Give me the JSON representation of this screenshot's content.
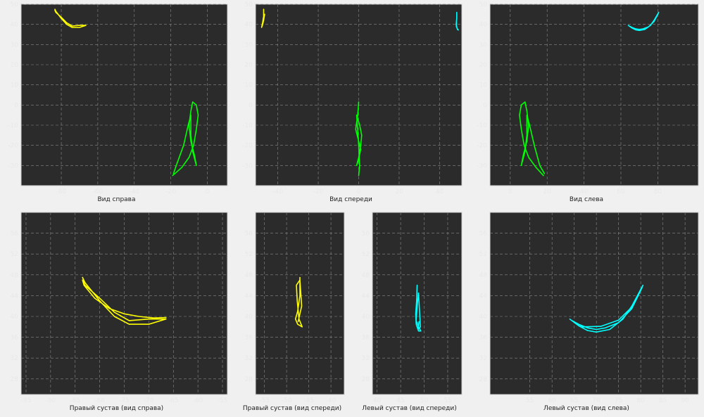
{
  "chart_data": [
    {
      "type": "line",
      "title": "Вид справа",
      "xlim": [
        -102,
        11
      ],
      "ylim": [
        -40,
        50
      ],
      "xticks": [
        -80,
        -60,
        -40,
        -20,
        0
      ],
      "yticks": [
        -30,
        -20,
        -10,
        0,
        10,
        20,
        30,
        40,
        50
      ],
      "grid": true,
      "series": [
        {
          "color": "#ffff00",
          "x": [
            -83.5,
            -83,
            -80,
            -77,
            -74,
            -70,
            -66.5,
            -70,
            -74,
            -77,
            -80,
            -83,
            -83.5
          ],
          "y": [
            47.5,
            46.5,
            43,
            40,
            38.5,
            38.5,
            39.5,
            39.5,
            39.2,
            40.8,
            43.5,
            46,
            47
          ]
        },
        {
          "color": "#00ff00",
          "x": [
            -19,
            -14,
            -10,
            -7.5,
            -6,
            -5,
            -6,
            -8,
            -9,
            -10,
            -9,
            -7,
            -6,
            -8,
            -9,
            -9,
            -10.5,
            -13,
            -17,
            -18.5
          ],
          "y": [
            -35,
            -31,
            -26,
            -20,
            -12,
            -5,
            0,
            1.5,
            -3,
            -10,
            -18,
            -25,
            -30,
            -23,
            -15,
            -5,
            -10,
            -20,
            -30,
            -34
          ]
        }
      ]
    },
    {
      "type": "line",
      "title": "Вид спереди",
      "xlim": [
        -51,
        51
      ],
      "ylim": [
        -40,
        50
      ],
      "xticks": [
        -40,
        -20,
        0,
        20,
        40
      ],
      "yticks": [
        -30,
        -20,
        -10,
        0,
        10,
        20,
        30,
        40,
        50
      ],
      "grid": true,
      "series": [
        {
          "color": "#ffff00",
          "x": [
            -47,
            -47,
            -47.5,
            -48,
            -47.5,
            -47,
            -46.5
          ],
          "y": [
            47.5,
            44,
            41,
            38.5,
            40,
            42,
            45
          ]
        },
        {
          "color": "#00ffff",
          "x": [
            48.5,
            48.5,
            48.2,
            48.8,
            49.3,
            48.8,
            48.3,
            48.4
          ],
          "y": [
            46,
            43,
            40,
            37.5,
            37.2,
            37.8,
            39,
            41
          ]
        },
        {
          "color": "#00ff00",
          "x": [
            0,
            -0.5,
            -1.5,
            0,
            1,
            0,
            -1,
            0,
            1,
            1.5,
            0.5,
            -1,
            0,
            0.5,
            0
          ],
          "y": [
            1.5,
            -5,
            -12,
            -18,
            -22,
            -27,
            -30,
            -26,
            -20,
            -15,
            -10,
            -5,
            -20,
            -30,
            -35
          ]
        }
      ]
    },
    {
      "type": "line",
      "title": "Вид слева",
      "xlim": [
        -11,
        102
      ],
      "ylim": [
        -40,
        50
      ],
      "xticks": [
        0,
        20,
        40,
        60,
        80
      ],
      "yticks": [
        -30,
        -20,
        -10,
        0,
        10,
        20,
        30,
        40,
        50
      ],
      "grid": true,
      "series": [
        {
          "color": "#00ffff",
          "x": [
            64,
            66,
            68,
            70,
            73,
            76,
            78,
            80.5,
            80,
            78,
            75,
            72,
            70,
            68,
            66,
            64.5
          ],
          "y": [
            39.5,
            38.2,
            37.3,
            37,
            37.5,
            39.5,
            42,
            46,
            45,
            41.5,
            38.8,
            37.8,
            37.5,
            37.8,
            38.5,
            39.2
          ]
        },
        {
          "color": "#00ff00",
          "x": [
            18,
            14,
            10,
            7.5,
            6,
            5,
            6,
            8,
            9,
            10,
            9,
            7,
            6,
            8,
            9,
            9,
            10.5,
            13,
            16,
            18.5
          ],
          "y": [
            -35,
            -31,
            -26,
            -20,
            -12,
            -5,
            0,
            1.5,
            -3,
            -10,
            -18,
            -25,
            -30,
            -23,
            -15,
            -5,
            -10,
            -20,
            -30,
            -34
          ]
        }
      ]
    },
    {
      "type": "line",
      "title": "Правый сустав (вид справа)",
      "xlim": [
        -96,
        -54
      ],
      "ylim": [
        25,
        60
      ],
      "xticks": [
        -95,
        -90,
        -85,
        -80,
        -75,
        -70,
        -65,
        -60,
        -55
      ],
      "yticks": [
        28,
        32,
        36,
        40,
        44,
        48,
        52,
        56
      ],
      "grid": true,
      "series": [
        {
          "color": "#ffff00",
          "x": [
            -83.5,
            -83,
            -80,
            -77,
            -74,
            -70,
            -66.5,
            -70,
            -74,
            -77,
            -80,
            -83,
            -83.5,
            -83.2,
            -81,
            -78,
            -75,
            -72,
            -69,
            -66.5
          ],
          "y": [
            47.5,
            46.5,
            43,
            40,
            38.5,
            38.5,
            39.5,
            39.5,
            39.2,
            40.8,
            43.5,
            46,
            47,
            46,
            43.5,
            41.5,
            40.5,
            40,
            39.7,
            39.8
          ]
        }
      ]
    },
    {
      "type": "line",
      "title": "Правый сустав (вид спереди)",
      "xlim": [
        -57,
        -37
      ],
      "ylim": [
        25,
        60
      ],
      "xticks": [
        -55,
        -50,
        -45,
        -40
      ],
      "yticks": [
        28,
        32,
        36,
        40,
        44,
        48,
        52,
        56
      ],
      "grid": true,
      "series": [
        {
          "color": "#ffff00",
          "x": [
            -47,
            -47,
            -47.5,
            -48,
            -47.5,
            -46.5,
            -47.2,
            -47.6,
            -47.8,
            -47,
            -46.6,
            -47.4
          ],
          "y": [
            47.5,
            44,
            41,
            39.5,
            38.5,
            38,
            39.5,
            43,
            46,
            47,
            42,
            39
          ]
        }
      ]
    },
    {
      "type": "line",
      "title": "Левый сустав (вид спереди)",
      "xlim": [
        39,
        58
      ],
      "ylim": [
        25,
        60
      ],
      "xticks": [
        40,
        45,
        50,
        55
      ],
      "yticks": [
        28,
        32,
        36,
        40,
        44,
        48,
        52,
        56
      ],
      "grid": true,
      "series": [
        {
          "color": "#00ffff",
          "x": [
            48.5,
            48.4,
            48.2,
            48.3,
            48.8,
            49.3,
            48.8,
            48.3,
            48.5,
            48.8,
            49.2,
            48.7,
            48.9
          ],
          "y": [
            46,
            43,
            40.5,
            38.5,
            37.2,
            37.2,
            38,
            39.2,
            42,
            44.5,
            38,
            37.5,
            39
          ]
        }
      ]
    },
    {
      "type": "line",
      "title": "Левый сустав (вид слева)",
      "xlim": [
        46,
        93
      ],
      "ylim": [
        25,
        60
      ],
      "xticks": [
        55,
        60,
        65,
        70,
        75,
        80,
        85,
        90
      ],
      "yticks": [
        28,
        32,
        36,
        40,
        44,
        48,
        52,
        56
      ],
      "grid": true,
      "series": [
        {
          "color": "#00ffff",
          "x": [
            64,
            66,
            68,
            70,
            73,
            76,
            78,
            80.5,
            80,
            78,
            75,
            72,
            70,
            68,
            66,
            64.5,
            67,
            71,
            75,
            78,
            80.3
          ],
          "y": [
            39.5,
            38.2,
            37.3,
            37,
            37.5,
            39.5,
            42,
            46,
            45,
            41.5,
            38.8,
            37.8,
            37.5,
            37.8,
            38.5,
            39.2,
            38,
            38.1,
            39.3,
            41.8,
            45.5
          ]
        }
      ]
    }
  ]
}
